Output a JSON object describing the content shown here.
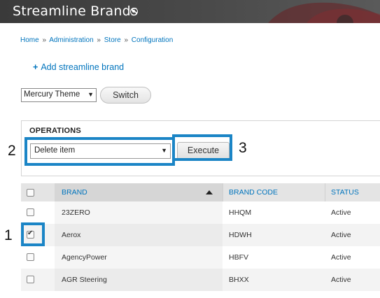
{
  "header": {
    "title": "Streamline Brands"
  },
  "breadcrumb": [
    "Home",
    "Administration",
    "Store",
    "Configuration"
  ],
  "breadcrumb_separator": "»",
  "action_link": {
    "plus": "+",
    "label": "Add streamline brand"
  },
  "theme_switcher": {
    "selected": "Mercury Theme",
    "button_label": "Switch"
  },
  "operations": {
    "title": "OPERATIONS",
    "selected": "Delete item",
    "execute_label": "Execute"
  },
  "callouts": [
    "1",
    "2",
    "3"
  ],
  "table": {
    "columns": [
      "BRAND",
      "BRAND CODE",
      "STATUS"
    ],
    "rows": [
      {
        "brand": "23ZERO",
        "code": "HHQM",
        "status": "Active",
        "checked": false
      },
      {
        "brand": "Aerox",
        "code": "HDWH",
        "status": "Active",
        "checked": true
      },
      {
        "brand": "AgencyPower",
        "code": "HBFV",
        "status": "Active",
        "checked": false
      },
      {
        "brand": "AGR Steering",
        "code": "BHXX",
        "status": "Active",
        "checked": false
      }
    ]
  },
  "colors": {
    "link": "#0074bd",
    "callout": "#1b85c6",
    "header_bg": "#3f3f3f"
  }
}
